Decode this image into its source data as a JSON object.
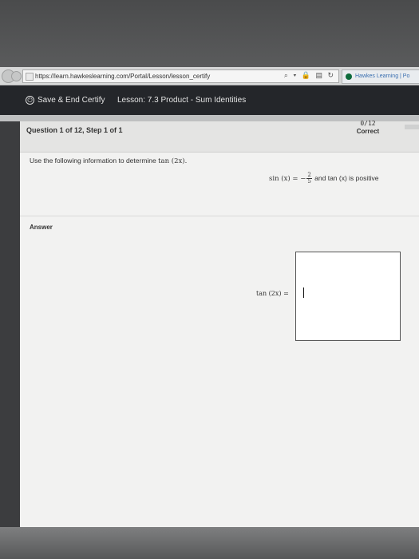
{
  "browser": {
    "url": "https://learn.hawkeslearning.com/Portal/Lesson/lesson_certify",
    "toolbar_icons": "⌕ ▾ 🔒 ▤ ↻",
    "tab_title": "Hawkes Learning | Po"
  },
  "header": {
    "save_icon": "⏻",
    "save_label": "Save & End Certify",
    "lesson_label": "Lesson: 7.3 Product - Sum Identities"
  },
  "question": {
    "title": "Question 1 of 12, Step 1 of 1",
    "score": "0/12",
    "status": "Correct",
    "prompt_text": "Use the following information to determine ",
    "prompt_expr": "tan (2x).",
    "given_left": "sin (x) = −",
    "given_num": "2",
    "given_den": "5",
    "given_right": " and tan (x) is positive"
  },
  "answer": {
    "section_label": "Answer",
    "input_label": "tan (2x) ="
  }
}
